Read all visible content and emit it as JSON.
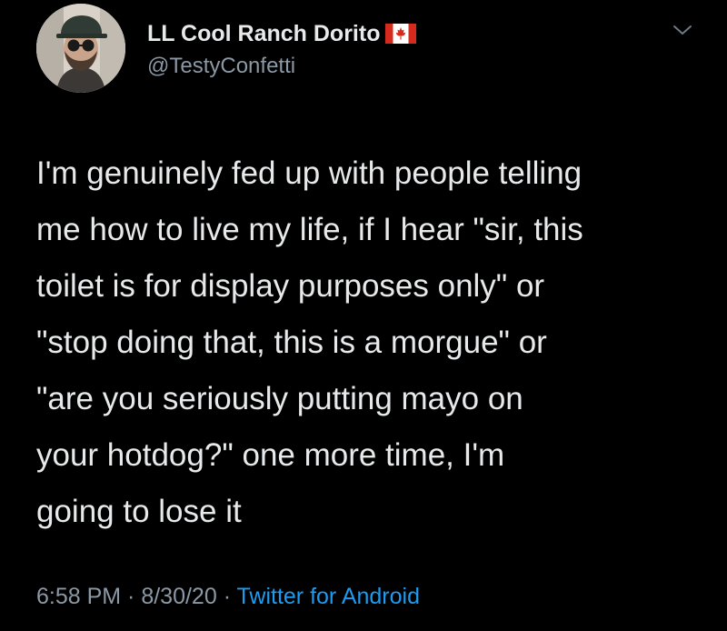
{
  "user": {
    "display_name": "LL Cool Ranch Dorito",
    "handle": "@TestyConfetti",
    "flag_icon": "canada-flag-icon"
  },
  "tweet": {
    "lines": [
      "I'm genuinely fed up with people telling",
      "me how to live my life, if I hear \"sir, this",
      "toilet is for display purposes only\" or",
      "\"stop doing that, this is a morgue\" or",
      "\"are you seriously putting mayo on",
      "your hotdog?\" one more time, I'm",
      "going to lose it"
    ]
  },
  "meta": {
    "time": "6:58 PM",
    "separator": " · ",
    "date": "8/30/20",
    "source": "Twitter for Android"
  },
  "colors": {
    "background": "#000000",
    "text": "#e7e9ea",
    "muted": "#8b98a5",
    "link": "#1d9bf0",
    "flag_red": "#d52b1e"
  }
}
